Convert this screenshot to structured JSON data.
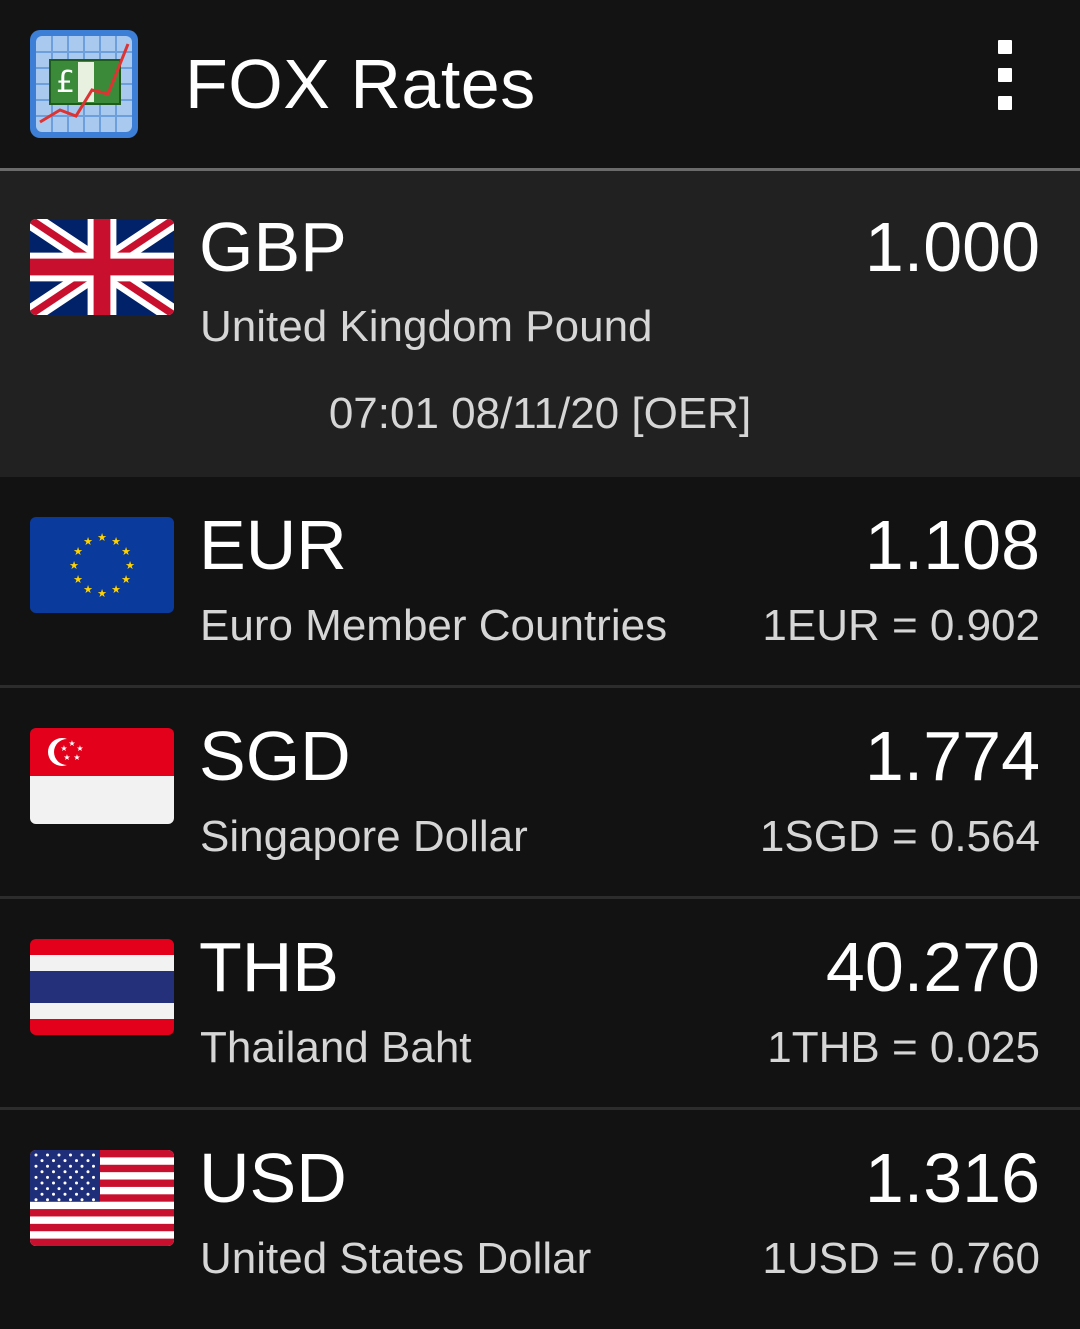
{
  "app": {
    "title": "FOX Rates"
  },
  "base": {
    "code": "GBP",
    "name": "United Kingdom Pound",
    "rate": "1.000",
    "timestamp": "07:01 08/11/20 [OER]"
  },
  "rows": [
    {
      "code": "EUR",
      "name": "Euro Member Countries",
      "rate": "1.108",
      "inverse": "1EUR = 0.902"
    },
    {
      "code": "SGD",
      "name": "Singapore Dollar",
      "rate": "1.774",
      "inverse": "1SGD = 0.564"
    },
    {
      "code": "THB",
      "name": "Thailand Baht",
      "rate": "40.270",
      "inverse": "1THB = 0.025"
    },
    {
      "code": "USD",
      "name": "United States Dollar",
      "rate": "1.316",
      "inverse": "1USD = 0.760"
    }
  ],
  "icons": {
    "app_logo": "fox-rates-logo-icon",
    "overflow": "more-vert-icon",
    "flags": [
      "flag-gb-icon",
      "flag-eu-icon",
      "flag-sg-icon",
      "flag-th-icon",
      "flag-us-icon"
    ]
  },
  "colors": {
    "background": "#121212",
    "base_row_background": "#212121",
    "primary_text": "#ffffff",
    "secondary_text": "#d6d6d6"
  }
}
